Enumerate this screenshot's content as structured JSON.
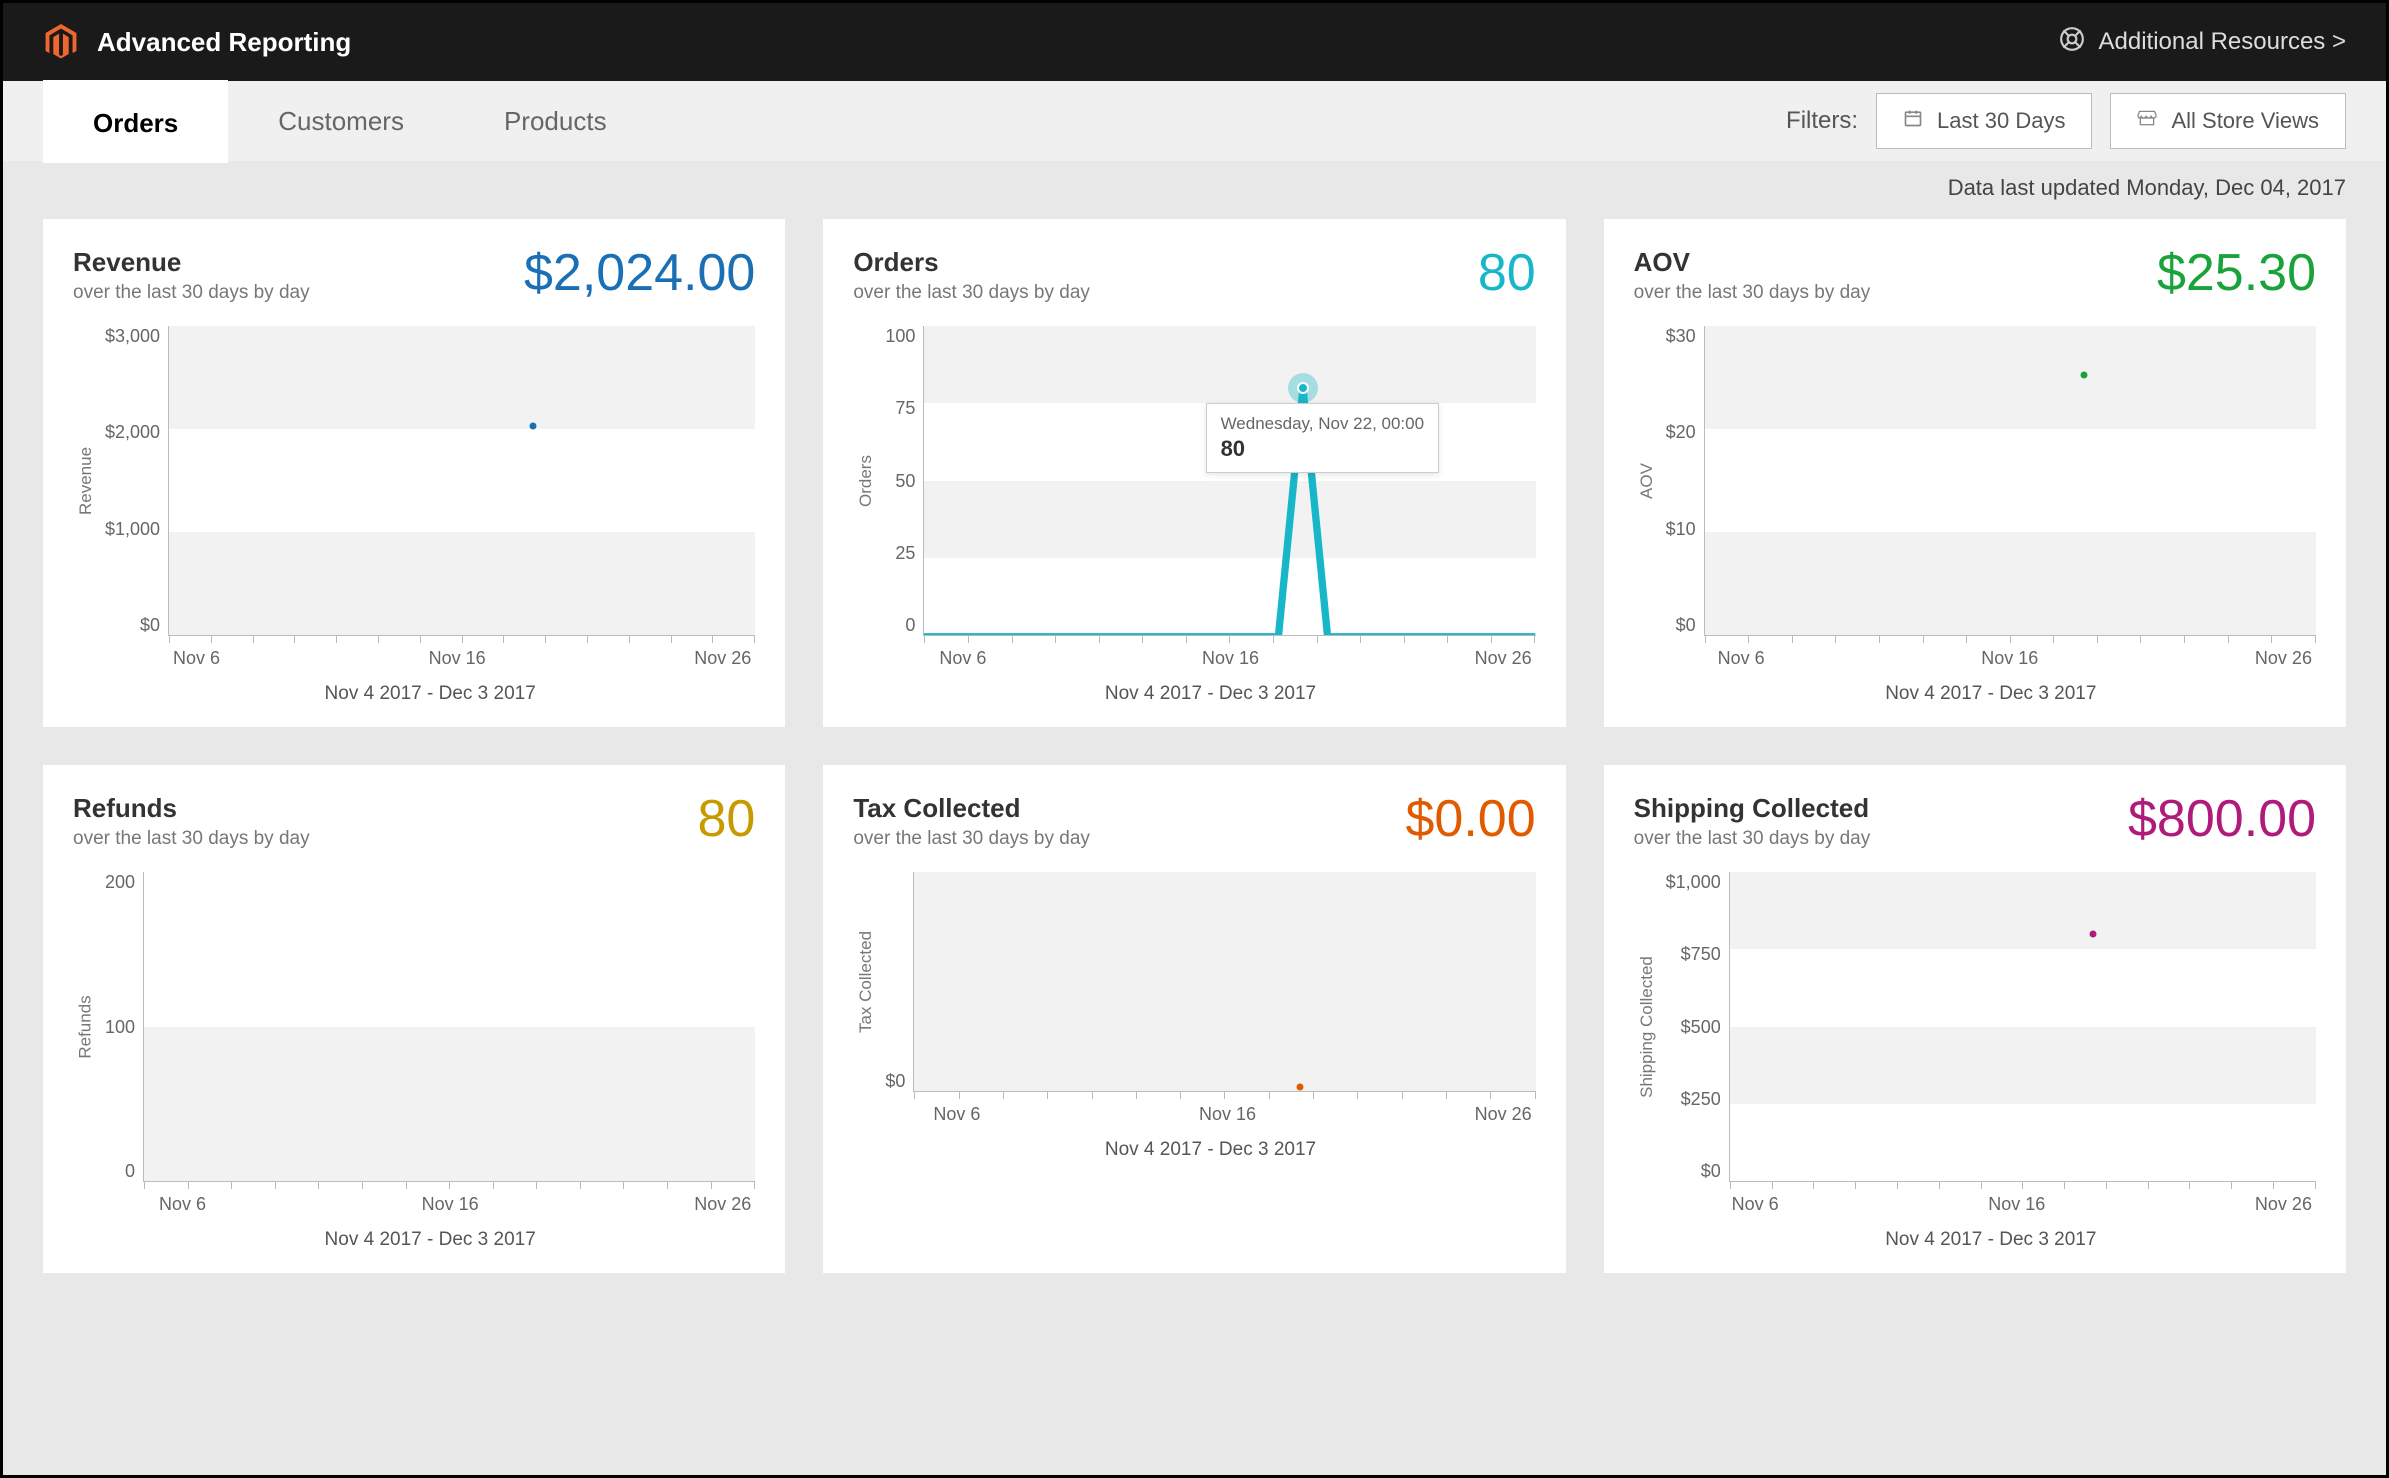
{
  "header": {
    "title": "Advanced Reporting",
    "resources_label": "Additional Resources >"
  },
  "tabs": [
    "Orders",
    "Customers",
    "Products"
  ],
  "active_tab": 0,
  "filters": {
    "label": "Filters:",
    "date_range": "Last 30 Days",
    "store": "All Store Views"
  },
  "updated": "Data last updated Monday, Dec 04, 2017",
  "subtext": "over the last 30 days by day",
  "date_caption": "Nov 4 2017 - Dec 3 2017",
  "x_ticks": [
    "Nov 6",
    "Nov 16",
    "Nov 26"
  ],
  "cards": {
    "revenue": {
      "title": "Revenue",
      "value": "$2,024.00",
      "ylabel": "Revenue"
    },
    "orders": {
      "title": "Orders",
      "value": "80",
      "ylabel": "Orders",
      "tooltip_title": "Wednesday, Nov 22, 00:00",
      "tooltip_value": "80"
    },
    "aov": {
      "title": "AOV",
      "value": "$25.30",
      "ylabel": "AOV"
    },
    "refunds": {
      "title": "Refunds",
      "value": "80",
      "ylabel": "Refunds"
    },
    "tax": {
      "title": "Tax Collected",
      "value": "$0.00",
      "ylabel": "Tax Collected"
    },
    "shipping": {
      "title": "Shipping Collected",
      "value": "$800.00",
      "ylabel": "Shipping Collected"
    }
  },
  "yticks": {
    "revenue": [
      "$3,000",
      "$2,000",
      "$1,000",
      "$0"
    ],
    "orders": [
      "100",
      "75",
      "50",
      "25",
      "0"
    ],
    "aov": [
      "$30",
      "$20",
      "$10",
      "$0"
    ],
    "refunds": [
      "200",
      "100",
      "0"
    ],
    "tax": [
      "$0"
    ],
    "shipping": [
      "$1,000",
      "$750",
      "$500",
      "$250",
      "$0"
    ]
  },
  "chart_data": [
    {
      "card": "revenue",
      "type": "scatter",
      "title": "Revenue",
      "xlabel": "",
      "ylabel": "Revenue",
      "xrange": [
        "2017-11-04",
        "2017-12-03"
      ],
      "ylim": [
        0,
        3000
      ],
      "x": [
        "2017-11-22"
      ],
      "y": [
        2024
      ]
    },
    {
      "card": "orders",
      "type": "line",
      "title": "Orders",
      "xlabel": "",
      "ylabel": "Orders",
      "xrange": [
        "2017-11-04",
        "2017-12-03"
      ],
      "ylim": [
        0,
        100
      ],
      "categories": [
        "2017-11-04",
        "2017-11-05",
        "2017-11-06",
        "2017-11-07",
        "2017-11-08",
        "2017-11-09",
        "2017-11-10",
        "2017-11-11",
        "2017-11-12",
        "2017-11-13",
        "2017-11-14",
        "2017-11-15",
        "2017-11-16",
        "2017-11-17",
        "2017-11-18",
        "2017-11-19",
        "2017-11-20",
        "2017-11-21",
        "2017-11-22",
        "2017-11-23",
        "2017-11-24",
        "2017-11-25",
        "2017-11-26",
        "2017-11-27",
        "2017-11-28",
        "2017-11-29",
        "2017-11-30",
        "2017-12-01",
        "2017-12-02",
        "2017-12-03"
      ],
      "values": [
        0,
        0,
        0,
        0,
        0,
        0,
        0,
        0,
        0,
        0,
        0,
        0,
        0,
        0,
        0,
        0,
        0,
        0,
        80,
        0,
        0,
        0,
        0,
        0,
        0,
        0,
        0,
        0,
        0,
        0
      ],
      "highlight_tooltip": {
        "x": "2017-11-22",
        "label": "Wednesday, Nov 22, 00:00",
        "value": 80
      }
    },
    {
      "card": "aov",
      "type": "scatter",
      "title": "AOV",
      "xlabel": "",
      "ylabel": "AOV",
      "xrange": [
        "2017-11-04",
        "2017-12-03"
      ],
      "ylim": [
        0,
        30
      ],
      "x": [
        "2017-11-22"
      ],
      "y": [
        25.3
      ]
    },
    {
      "card": "refunds",
      "type": "scatter",
      "title": "Refunds",
      "xlabel": "",
      "ylabel": "Refunds",
      "xrange": [
        "2017-11-04",
        "2017-12-03"
      ],
      "ylim": [
        0,
        200
      ],
      "x": [],
      "y": []
    },
    {
      "card": "tax",
      "type": "scatter",
      "title": "Tax Collected",
      "xlabel": "",
      "ylabel": "Tax Collected",
      "xrange": [
        "2017-11-04",
        "2017-12-03"
      ],
      "ylim": [
        0,
        0
      ],
      "x": [
        "2017-11-22"
      ],
      "y": [
        0
      ]
    },
    {
      "card": "shipping",
      "type": "scatter",
      "title": "Shipping Collected",
      "xlabel": "",
      "ylabel": "Shipping Collected",
      "xrange": [
        "2017-11-04",
        "2017-12-03"
      ],
      "ylim": [
        0,
        1000
      ],
      "x": [
        "2017-11-22"
      ],
      "y": [
        800
      ]
    }
  ],
  "colors": {
    "revenue": "#1b6fb5",
    "orders": "#17b6c9",
    "aov": "#1aa33a",
    "refunds": "#c79a00",
    "tax": "#e25a00",
    "shipping": "#b01a7a"
  }
}
